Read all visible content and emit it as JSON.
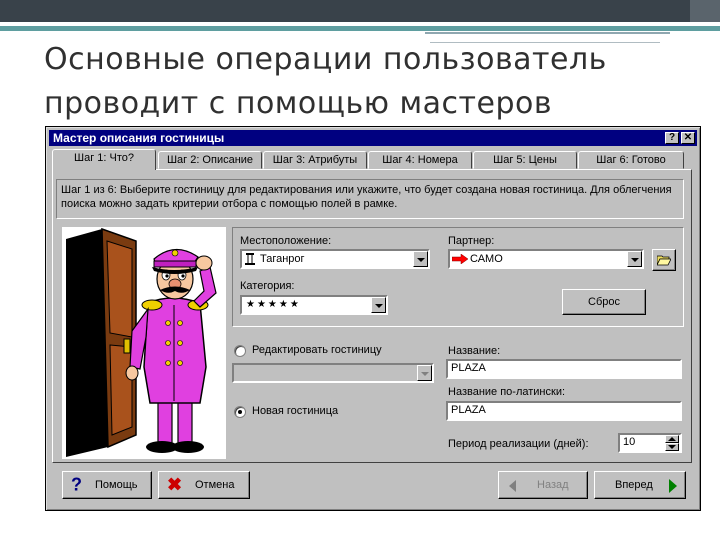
{
  "slide": {
    "title_line1": "Основные операции пользователь",
    "title_line2": "проводит с помощью мастеров"
  },
  "window": {
    "title": "Мастер описания гостиницы",
    "help_btn": "?",
    "close_btn": "✕"
  },
  "tabs": [
    {
      "label": "Шаг 1: Что?",
      "active": true
    },
    {
      "label": "Шаг 2: Описание"
    },
    {
      "label": "Шаг 3: Атрибуты"
    },
    {
      "label": "Шаг 4: Номера"
    },
    {
      "label": "Шаг 5: Цены"
    },
    {
      "label": "Шаг 6: Готово"
    }
  ],
  "info_text": "Шаг 1 из 6: Выберите гостиницу для редактирования или укажите, что будет создана новая гостиница. Для облегчения поиска можно задать критерии отбора с помощью полей в рамке.",
  "filters": {
    "location_label": "Местоположение:",
    "location_value": "Таганрог",
    "partner_label": "Партнер:",
    "partner_value": "САМО",
    "category_label": "Категория:",
    "category_value": "★★★★★",
    "reset_button": "Сброс"
  },
  "mode": {
    "edit_label": "Редактировать гостиницу",
    "new_label": "Новая гостиница",
    "selected": "new"
  },
  "fields": {
    "name_label": "Название:",
    "name_value": "PLAZA",
    "latin_label": "Название по-латински:",
    "latin_value": "PLAZA",
    "period_label": "Период реализации (дней):",
    "period_value": "10"
  },
  "buttons": {
    "help": "Помощь",
    "cancel": "Отмена",
    "back": "Назад",
    "next": "Вперед"
  },
  "colors": {
    "titlebar": "#000080",
    "dialog_bg": "#c0c0c0",
    "accent_teal": "#5f9ea0",
    "partner_arrow": "#ff0000",
    "cancel_x": "#cc0000",
    "next_arrow": "#008000",
    "help_icon": "#000080"
  }
}
